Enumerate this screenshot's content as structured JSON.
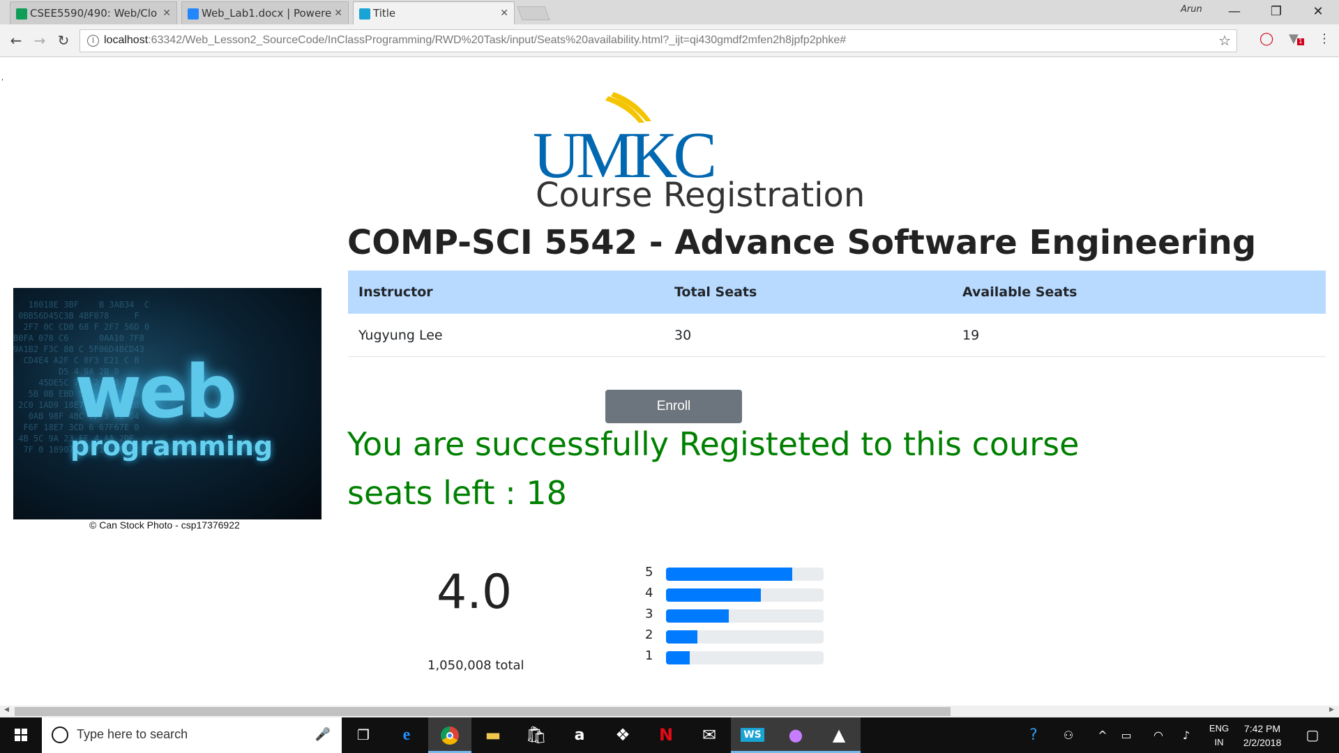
{
  "browser": {
    "tabs": [
      {
        "title": "CSEE5590/490: Web/Clo",
        "icon": "sheets-icon",
        "color": "#0f9d58"
      },
      {
        "title": "Web_Lab1.docx | Powere",
        "icon": "box-icon",
        "color": "#2486fc"
      },
      {
        "title": "Title",
        "icon": "webstorm-icon",
        "color": "#1aa3d5"
      }
    ],
    "user": "Arun",
    "url_host": "localhost",
    "url_path": ":63342/Web_Lesson2_SourceCode/InClassProgramming/RWD%20Task/input/Seats%20availability.html?_ijt=qi430gmdf2mfen2h8jpfp2phke#",
    "extension_badge": "1"
  },
  "page": {
    "logo_text": "UMKC",
    "title": "Course Registration",
    "course": "COMP-SCI 5542 - Advance Software Engineering",
    "image_word1": "web",
    "image_word2": "programming",
    "image_credit": "© Can Stock Photo - csp17376922",
    "table": {
      "headers": [
        "Instructor",
        "Total Seats",
        "Available Seats"
      ],
      "rows": [
        [
          "Yugyung Lee",
          "30",
          "19"
        ]
      ]
    },
    "enroll_label": "Enroll",
    "success_msg": "You are successfully Registeted to this course",
    "seats_left": "seats left : 18",
    "rating": {
      "average": "4.0",
      "total": "1,050,008 total",
      "bars": [
        {
          "label": "5",
          "fraction": 0.8
        },
        {
          "label": "4",
          "fraction": 0.6
        },
        {
          "label": "3",
          "fraction": 0.4
        },
        {
          "label": "2",
          "fraction": 0.2
        },
        {
          "label": "1",
          "fraction": 0.15
        }
      ]
    }
  },
  "taskbar": {
    "search_placeholder": "Type here to search",
    "lang_line1": "ENG",
    "lang_line2": "IN",
    "time": "7:42 PM",
    "date": "2/2/2018",
    "icons": [
      "task-view-icon",
      "edge-icon",
      "chrome-icon",
      "file-explorer-icon",
      "store-icon",
      "amazon-icon",
      "dropbox-icon",
      "netflix-icon",
      "mail-icon",
      "webstorm-icon",
      "github-icon",
      "photos-icon"
    ]
  },
  "colors": {
    "accent": "#007bff",
    "success": "#008000",
    "table_header": "#b8daff",
    "button": "#6c757d"
  }
}
